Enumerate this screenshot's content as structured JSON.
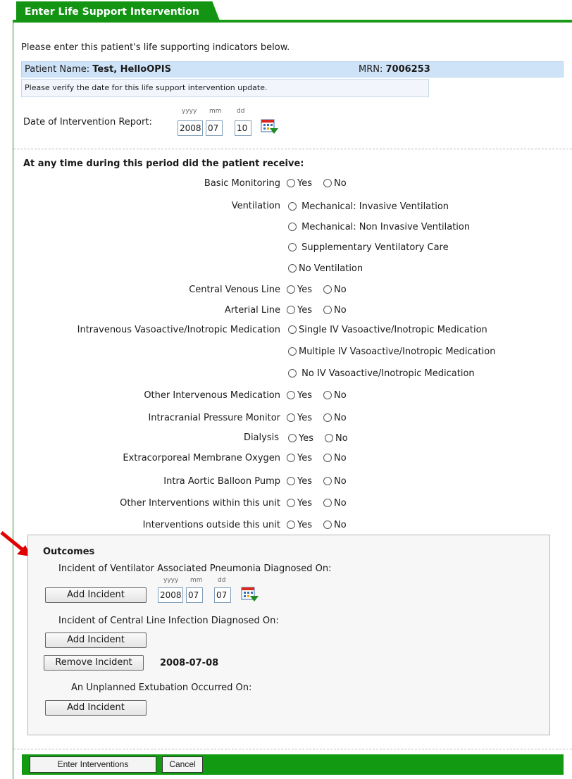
{
  "header": {
    "title": "Enter Life Support Intervention"
  },
  "intro": "Please enter this patient's life supporting indicators below.",
  "patient": {
    "name_label": "Patient Name:",
    "name": "Test, HelloOPIS",
    "mrn_label": "MRN:",
    "mrn": "7006253"
  },
  "verify_note": "Please verify the date for this life support intervention update.",
  "date_report": {
    "label": "Date of Intervention Report:",
    "yyyy_hint": "yyyy",
    "mm_hint": "mm",
    "dd_hint": "dd",
    "year": "2008",
    "month": "07",
    "day": "10"
  },
  "question": "At any time during this period did the patient receive:",
  "yes": "Yes",
  "no": "No",
  "items": {
    "basic": "Basic Monitoring",
    "ventilation": "Ventilation",
    "vent_opts": [
      "Mechanical: Invasive Ventilation",
      "Mechanical: Non Invasive Ventilation",
      "Supplementary Ventilatory Care",
      "No Ventilation"
    ],
    "cvl": "Central Venous Line",
    "arterial": "Arterial Line",
    "iv": "Intravenous Vasoactive/Inotropic Medication",
    "iv_opts": [
      "Single IV Vasoactive/Inotropic Medication",
      "Multiple IV Vasoactive/Inotropic Medication",
      "No IV Vasoactive/Inotropic Medication"
    ],
    "other_iv": "Other Intervenous Medication",
    "icp": "Intracranial Pressure Monitor",
    "dialysis": "Dialysis",
    "ecmo": "Extracorporeal Membrane Oxygen",
    "iabp": "Intra Aortic Balloon Pump",
    "other_within": "Other Interventions within this unit",
    "outside": "Interventions outside this unit"
  },
  "outcomes": {
    "title": "Outcomes",
    "vap_label": "Incident of Ventilator Associated Pneumonia Diagnosed On:",
    "vap_date": {
      "year": "2008",
      "month": "07",
      "day": "07"
    },
    "cli_label": "Incident of Central Line Infection Diagnosed On:",
    "cli_date": "2008-07-08",
    "extub_label": "An Unplanned Extubation Occurred On:",
    "add_incident": "Add Incident",
    "remove_incident": "Remove Incident"
  },
  "footer": {
    "submit": "Enter Interventions",
    "cancel": "Cancel"
  },
  "colors": {
    "brand_green": "#139413",
    "patient_bar": "#cfe3f8",
    "arrow_red": "#e00000"
  }
}
